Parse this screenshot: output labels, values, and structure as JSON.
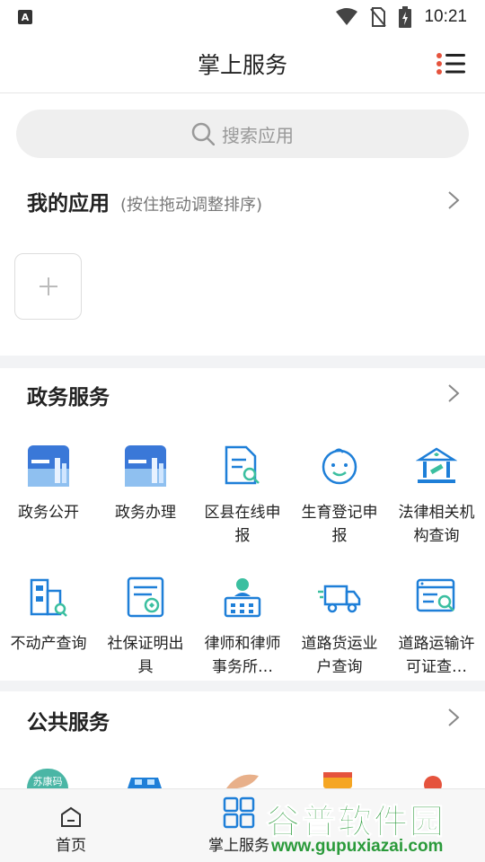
{
  "status_bar": {
    "time": "10:21",
    "left_icon": "A"
  },
  "header": {
    "title": "掌上服务"
  },
  "search": {
    "placeholder": "搜索应用"
  },
  "my_apps": {
    "title": "我的应用",
    "hint": "(按住拖动调整排序)"
  },
  "gov_services": {
    "title": "政务服务",
    "items": [
      {
        "label": "政务公开",
        "icon": "gov-open-icon"
      },
      {
        "label": "政务办理",
        "icon": "gov-handle-icon"
      },
      {
        "label": "区县在线申报",
        "icon": "document-search-icon"
      },
      {
        "label": "生育登记申报",
        "icon": "baby-face-icon"
      },
      {
        "label": "法律相关机构查询",
        "icon": "court-gavel-icon"
      },
      {
        "label": "不动产查询",
        "icon": "building-search-icon"
      },
      {
        "label": "社保证明出具",
        "icon": "certificate-icon"
      },
      {
        "label": "律师和律师事务所…",
        "icon": "lawyer-office-icon"
      },
      {
        "label": "道路货运业户查询",
        "icon": "truck-icon"
      },
      {
        "label": "道路运输许可证查…",
        "icon": "license-search-icon"
      }
    ]
  },
  "public_services": {
    "title": "公共服务",
    "partial_badge": "苏康码"
  },
  "bottom_nav": {
    "home": "首页",
    "services": "掌上服务"
  },
  "watermark": {
    "main": "谷普软件园",
    "url": "www.gupuxiazai.com"
  },
  "colors": {
    "accent": "#1e7fd8",
    "text": "#222222",
    "muted": "#999999"
  }
}
